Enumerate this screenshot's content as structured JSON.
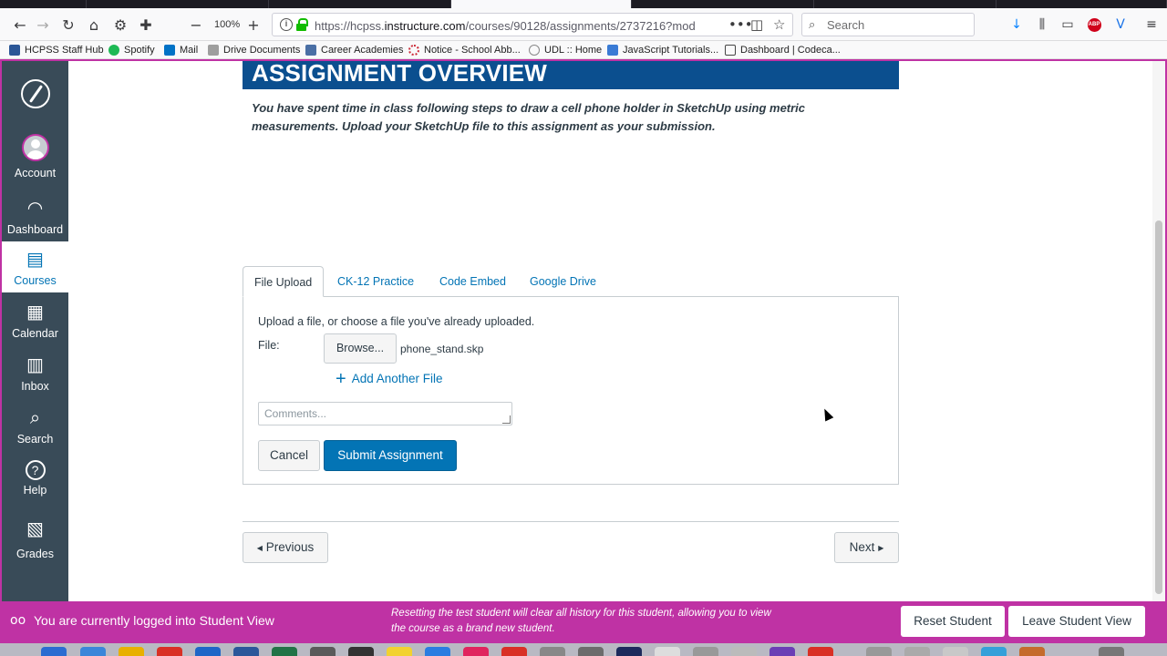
{
  "browser": {
    "zoom": "100%",
    "url_prefix": "https://hcpss.",
    "url_domain": "instructure.com",
    "url_path": "/courses/90128/assignments/2737216?mod",
    "search_placeholder": "Search"
  },
  "bookmarks": [
    {
      "label": "HCPSS Staff Hub",
      "color": "#2b5797"
    },
    {
      "label": "Spotify",
      "color": "#1db954"
    },
    {
      "label": "Mail",
      "color": "#0072c6"
    },
    {
      "label": "Drive Documents",
      "color": "#9e9e9e"
    },
    {
      "label": "Career Academies",
      "color": "#4a6fa5"
    },
    {
      "label": "Notice - School Abb...",
      "color": "#cc2936"
    },
    {
      "label": "UDL :: Home",
      "color": "#888888"
    },
    {
      "label": "JavaScript Tutorials...",
      "color": "#3a7bd5"
    },
    {
      "label": "Dashboard | Codeca...",
      "color": "#444444"
    }
  ],
  "nav": {
    "items": [
      {
        "label": "Account",
        "icon": "account-avatar-icon"
      },
      {
        "label": "Dashboard",
        "icon": "dashboard-icon"
      },
      {
        "label": "Courses",
        "icon": "courses-icon"
      },
      {
        "label": "Calendar",
        "icon": "calendar-icon"
      },
      {
        "label": "Inbox",
        "icon": "inbox-icon"
      },
      {
        "label": "Search",
        "icon": "search-icon"
      },
      {
        "label": "Help",
        "icon": "help-icon"
      },
      {
        "label": "Grades",
        "icon": "grades-icon"
      }
    ]
  },
  "assignment": {
    "header": "ASSIGNMENT OVERVIEW",
    "description": "You have spent time in class following steps to draw a cell phone holder in SketchUp using metric measurements. Upload your SketchUp file to this assignment as your submission."
  },
  "submission": {
    "tabs": [
      "File Upload",
      "CK-12 Practice",
      "Code Embed",
      "Google Drive"
    ],
    "intro": "Upload a file, or choose a file you've already uploaded.",
    "file_label": "File:",
    "browse_label": "Browse...",
    "file_name": "phone_stand.skp",
    "add_file_label": "Add Another File",
    "comments_placeholder": "Comments...",
    "cancel_label": "Cancel",
    "submit_label": "Submit Assignment"
  },
  "pager": {
    "previous_label": "Previous",
    "next_label": "Next"
  },
  "student_view": {
    "status": "You are currently logged into Student View",
    "note": "Resetting the test student will clear all history for this student, allowing you to view the course as a brand new student.",
    "reset_label": "Reset Student",
    "leave_label": "Leave Student View"
  },
  "colors": {
    "accent": "#0374b5",
    "header_bg": "#0b4f8f",
    "student_bar": "#bf32a4",
    "nav_bg": "#394b58"
  }
}
